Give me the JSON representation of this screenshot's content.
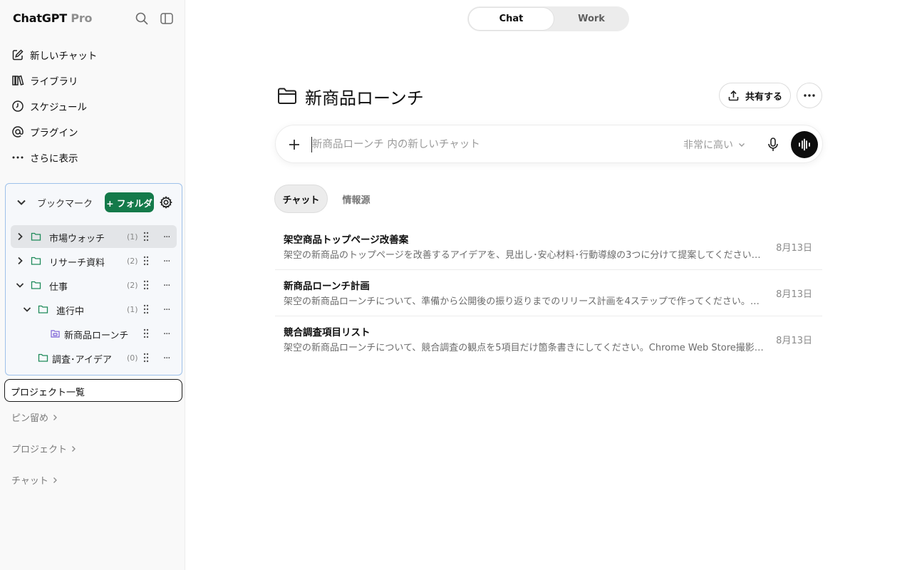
{
  "sidebar": {
    "brand": "ChatGPT",
    "brand_suffix": "Pro",
    "nav": [
      {
        "label": "新しいチャット",
        "icon": "edit-icon"
      },
      {
        "label": "ライブラリ",
        "icon": "library-icon"
      },
      {
        "label": "スケジュール",
        "icon": "clock-icon"
      },
      {
        "label": "プラグイン",
        "icon": "at-icon"
      },
      {
        "label": "さらに表示",
        "icon": "ellipsis-icon"
      }
    ],
    "bookmarks": {
      "title": "ブックマーク",
      "add_folder_label": "+ フォルダ",
      "items": [
        {
          "label": "市場ウォッチ",
          "count": "(1)",
          "expanded": false
        },
        {
          "label": "リサーチ資料",
          "count": "(2)",
          "expanded": false
        },
        {
          "label": "仕事",
          "count": "(2)",
          "expanded": true
        },
        {
          "label": "進行中",
          "count": "(1)",
          "expanded": true
        },
        {
          "label": "新商品ローンチ",
          "count": "",
          "type": "project"
        },
        {
          "label": "調査･アイデア",
          "count": "(0)"
        }
      ],
      "more_label": "..."
    },
    "project_list_label": "プロジェクト一覧",
    "sections": [
      "ピン留め",
      "プロジェクト",
      "チャット"
    ]
  },
  "mode_toggle": {
    "active": "Chat",
    "inactive": "Work"
  },
  "project": {
    "title": "新商品ローンチ",
    "share_label": "共有する"
  },
  "composer": {
    "placeholder": "新商品ローンチ 内の新しいチャット",
    "model_label": "非常に高い"
  },
  "tabs": {
    "active": "チャット",
    "inactive": "情報源"
  },
  "chats": [
    {
      "title": "架空商品トップページ改善案",
      "preview": "架空の新商品のトップページを改善するアイデアを、見出し･安心材料･行動導線の3つに分けて提案してください。撮影用のダミーです。",
      "date": "8月13日"
    },
    {
      "title": "新商品ローンチ計画",
      "preview": "架空の新商品ローンチについて、準備から公開後の振り返りまでのリリース計画を4ステップで作ってください。撮影用のダミーです。",
      "date": "8月13日"
    },
    {
      "title": "競合調査項目リスト",
      "preview": "架空の新商品ローンチについて、競合調査の観点を5項目だけ箇条書きにしてください。Chrome Web Store撮影用のダミーです。",
      "date": "8月13日"
    }
  ],
  "colors": {
    "accent_green": "#147a4a",
    "panel_border": "#9ec1ea",
    "folder_green": "#1f8a5a",
    "project_purple": "#7b5fd6"
  }
}
